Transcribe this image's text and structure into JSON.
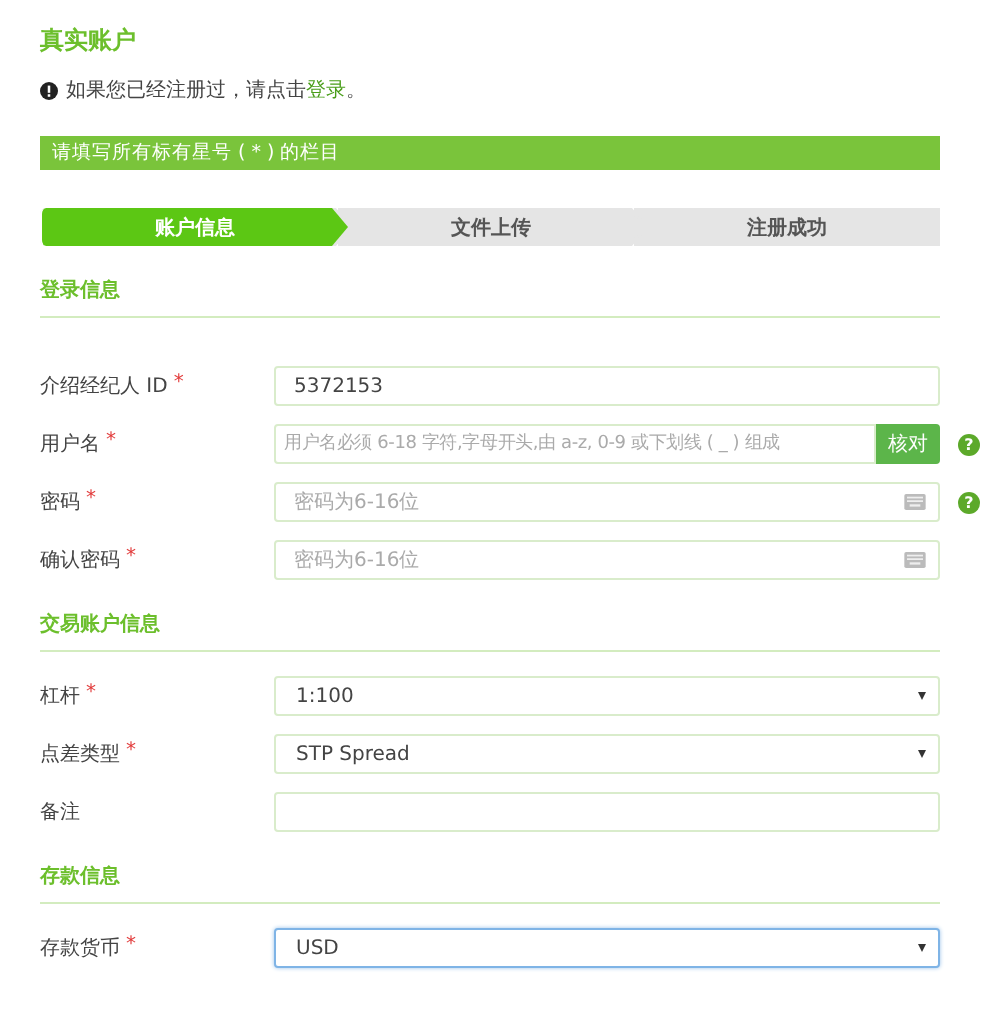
{
  "title": "真实账户",
  "notice": {
    "before": "如果您已经注册过，请点击",
    "link": "登录",
    "after": "。"
  },
  "banner": "请填写所有标有星号 ( * ) 的栏目",
  "steps": [
    {
      "label": "账户信息",
      "selected": true
    },
    {
      "label": "文件上传",
      "selected": false
    },
    {
      "label": "注册成功",
      "selected": false
    }
  ],
  "sections": [
    {
      "heading": "登录信息",
      "fields": [
        {
          "label": "介绍经纪人 ID",
          "mark": "*",
          "kind": "text",
          "value": "5372153"
        },
        {
          "label": "用户名",
          "mark": "*",
          "kind": "text",
          "placeholder": "用户名必须 6-18 字符,字母开头,由 a-z, 0-9 或下划线 ( _ ) 组成",
          "button": "核对",
          "help": "?"
        },
        {
          "label": "密码",
          "mark": "*",
          "kind": "password",
          "placeholder": "密码为6-16位",
          "help": "?"
        },
        {
          "label": "确认密码",
          "mark": "*",
          "kind": "password",
          "placeholder": "密码为6-16位"
        }
      ]
    },
    {
      "heading": "交易账户信息",
      "fields": [
        {
          "label": "杠杆",
          "mark": "*",
          "kind": "select",
          "value": "1:100"
        },
        {
          "label": "点差类型",
          "mark": "*",
          "kind": "select",
          "value": "STP Spread"
        },
        {
          "label": "备注",
          "kind": "text"
        }
      ]
    },
    {
      "heading": "存款信息",
      "fields": [
        {
          "label": "存款货币",
          "mark": "*",
          "kind": "select",
          "value": "USD",
          "focused": true
        }
      ]
    }
  ]
}
